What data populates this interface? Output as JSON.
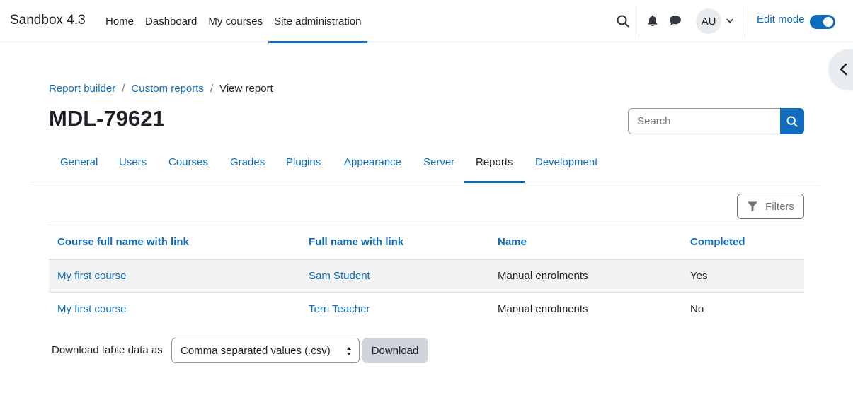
{
  "navbar": {
    "brand": "Sandbox 4.3",
    "items": [
      {
        "label": "Home"
      },
      {
        "label": "Dashboard"
      },
      {
        "label": "My courses"
      },
      {
        "label": "Site administration"
      }
    ],
    "active_item": "Site administration",
    "avatar_initials": "AU",
    "edit_mode_label": "Edit mode",
    "edit_mode_on": true,
    "icons": [
      "search-icon",
      "bell-icon",
      "chat-icon",
      "chevron-down-icon"
    ]
  },
  "drawer_toggle": {
    "icon": "chevron-left-icon"
  },
  "breadcrumb": {
    "items": [
      "Report builder",
      "Custom reports"
    ],
    "current": "View report",
    "separator": "/"
  },
  "page": {
    "title": "MDL-79621"
  },
  "search": {
    "placeholder": "Search",
    "icon": "search-icon"
  },
  "secondary_nav": {
    "tabs": [
      {
        "label": "General"
      },
      {
        "label": "Users"
      },
      {
        "label": "Courses"
      },
      {
        "label": "Grades"
      },
      {
        "label": "Plugins"
      },
      {
        "label": "Appearance"
      },
      {
        "label": "Server"
      },
      {
        "label": "Reports"
      },
      {
        "label": "Development"
      }
    ],
    "active_tab": "Reports"
  },
  "filters": {
    "label": "Filters",
    "icon": "filter-icon"
  },
  "table": {
    "columns": [
      "Course full name with link",
      "Full name with link",
      "Name",
      "Completed"
    ],
    "rows": [
      [
        "My first course",
        "Sam Student",
        "Manual enrolments",
        "Yes"
      ],
      [
        "My first course",
        "Terri Teacher",
        "Manual enrolments",
        "No"
      ]
    ]
  },
  "download": {
    "label": "Download table data as",
    "selected_format": "Comma separated values (.csv)",
    "button_label": "Download"
  },
  "colors": {
    "primary": "#0f6cbf",
    "text": "#1d2125",
    "stripe": "#f2f2f2",
    "border": "#dee2e6"
  }
}
